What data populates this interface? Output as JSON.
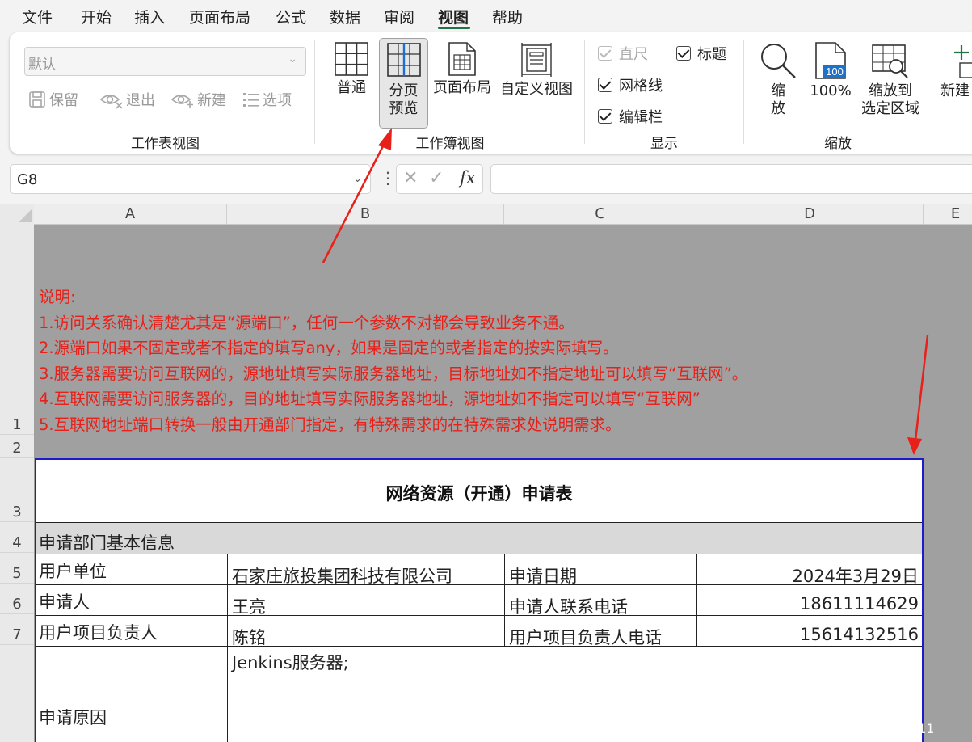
{
  "menu": {
    "items": [
      "文件",
      "开始",
      "插入",
      "页面布局",
      "公式",
      "数据",
      "审阅",
      "视图",
      "帮助"
    ],
    "active": "视图"
  },
  "ribbon": {
    "sheet_view": {
      "select_value": "默认",
      "keep": "保留",
      "exit": "退出",
      "new": "新建",
      "options": "选项",
      "label": "工作表视图"
    },
    "workbook_view": {
      "normal": "普通",
      "page_break_line1": "分页",
      "page_break_line2": "预览",
      "page_layout": "页面布局",
      "custom_views": "自定义视图",
      "label": "工作簿视图"
    },
    "show": {
      "ruler": "直尺",
      "gridlines": "网格线",
      "formula_bar": "编辑栏",
      "headings": "标题",
      "label": "显示"
    },
    "zoom": {
      "zoom_line1": "缩",
      "zoom_line2": "放",
      "hundred": "100%",
      "hundred_icon_text": "100",
      "zoom_sel_line1": "缩放到",
      "zoom_sel_line2": "选定区域",
      "label": "缩放"
    },
    "window": {
      "new": "新建"
    }
  },
  "formula_bar": {
    "name_box": "G8",
    "value": ""
  },
  "columns": [
    "A",
    "B",
    "C",
    "D",
    "E"
  ],
  "rows": [
    "1",
    "2",
    "3",
    "4",
    "5",
    "6",
    "7"
  ],
  "notes": [
    "说明:",
    "1.访问关系确认清楚尤其是“源端口”，任何一个参数不对都会导致业务不通。",
    "2.源端口如果不固定或者不指定的填写any，如果是固定的或者指定的按实际填写。",
    "3.服务器需要访问互联网的，源地址填写实际服务器地址，目标地址如不指定地址可以填写“互联网”。",
    "4.互联网需要访问服务器的，目的地址填写实际服务器地址，源地址如不指定可以填写“互联网”",
    "5.互联网地址端口转换一般由开通部门指定，有特殊需求的在特殊需求处说明需求。"
  ],
  "form": {
    "title": "网络资源（开通）申请表",
    "section": "申请部门基本信息",
    "user_unit_label": "用户单位",
    "user_unit_value": "石家庄旅投集团科技有限公司",
    "apply_date_label": "申请日期",
    "apply_date_value": "2024年3月29日",
    "applicant_label": "申请人",
    "applicant_value": "王亮",
    "applicant_phone_label": "申请人联系电话",
    "applicant_phone_value": "18611114629",
    "pm_label": "用户项目负责人",
    "pm_value": "陈铭",
    "pm_phone_label": "用户项目负责人电话",
    "pm_phone_value": "15614132516",
    "reason_label": "申请原因",
    "reason_value": "Jenkins服务器;"
  },
  "watermark": "CSDN @令狐少侠2011",
  "colors": {
    "accent": "#217346",
    "annotation_red": "#e8201a",
    "page_border": "#1c1cc8",
    "page_break_grey": "#a0a0a0"
  }
}
